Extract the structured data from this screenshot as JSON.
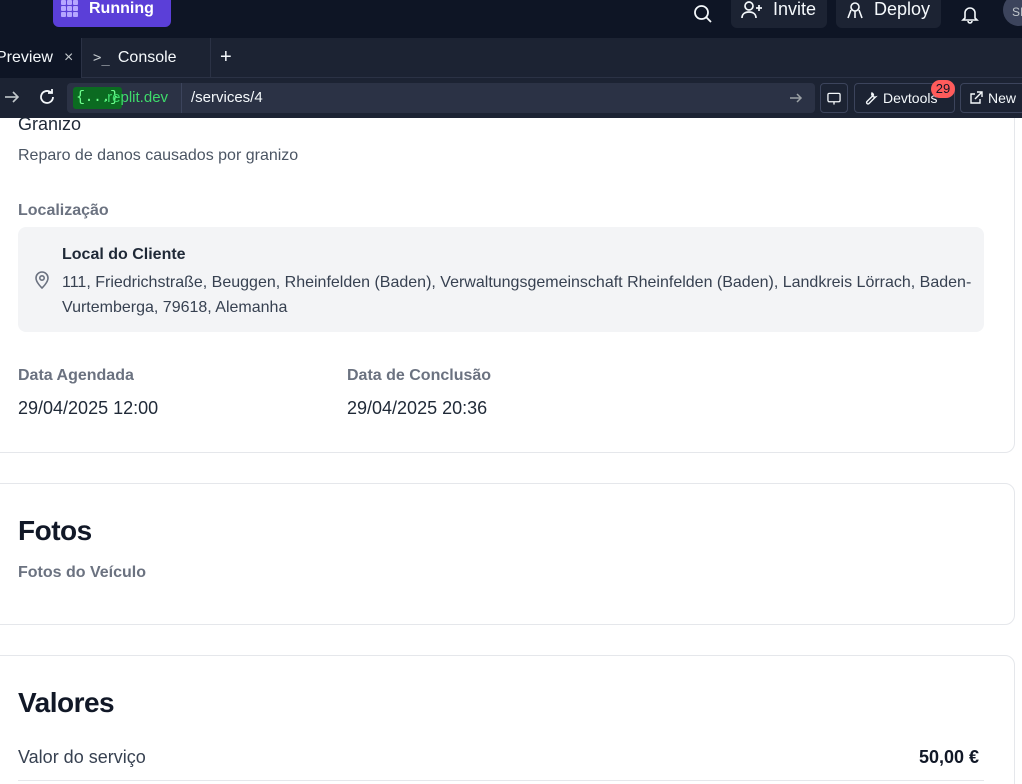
{
  "header": {
    "run_label": "Running",
    "invite_label": "Invite",
    "deploy_label": "Deploy",
    "avatar_initials": "SI"
  },
  "tabs": [
    {
      "label": "Preview",
      "close": "×"
    },
    {
      "label": "Console",
      "prompt": ">_"
    }
  ],
  "tab_add": "+",
  "urlbar": {
    "domain_chip": "{...}",
    "domain": ".replit.dev",
    "path": "/services/4",
    "devtools_label": "Devtools",
    "devtools_badge": "29",
    "new_tab_label": "New"
  },
  "service": {
    "name": "Granizo",
    "description": "Reparo de danos causados por granizo"
  },
  "location": {
    "label": "Localização",
    "title": "Local do Cliente",
    "address": "111, Friedrichstraße, Beuggen, Rheinfelden (Baden), Verwaltungsgemeinschaft Rheinfelden (Baden), Landkreis Lörrach, Baden-Vurtemberga, 79618, Alemanha"
  },
  "dates": {
    "scheduled_label": "Data Agendada",
    "scheduled_value": "29/04/2025 12:00",
    "completed_label": "Data de Conclusão",
    "completed_value": "29/04/2025 20:36"
  },
  "photos": {
    "title": "Fotos",
    "subtitle": "Fotos do Veículo"
  },
  "values": {
    "title": "Valores",
    "service_label": "Valor do serviço",
    "service_amount": "50,00 €"
  },
  "colors": {
    "topbar_bg": "#0e1525",
    "run_accent": "#5b3fd8",
    "badge": "#ff5b5b",
    "domain_green": "#3edb6b"
  }
}
